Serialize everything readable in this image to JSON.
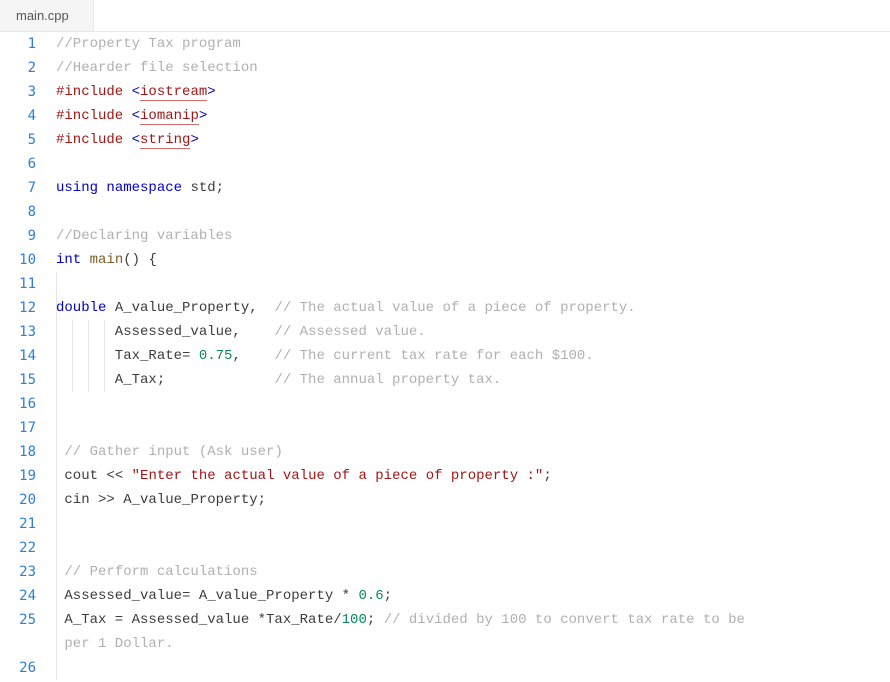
{
  "tab": {
    "filename": "main.cpp"
  },
  "lines": [
    {
      "num": "1",
      "tokens": [
        [
          "comment",
          "//Property Tax program"
        ]
      ]
    },
    {
      "num": "2",
      "tokens": [
        [
          "comment",
          "//Hearder file selection"
        ]
      ]
    },
    {
      "num": "3",
      "tokens": [
        [
          "preproc",
          "#include "
        ],
        [
          "angle",
          "<"
        ],
        [
          "include",
          "iostream"
        ],
        [
          "angle",
          ">"
        ]
      ]
    },
    {
      "num": "4",
      "tokens": [
        [
          "preproc",
          "#include "
        ],
        [
          "angle",
          "<"
        ],
        [
          "include",
          "iomanip"
        ],
        [
          "angle",
          ">"
        ]
      ]
    },
    {
      "num": "5",
      "tokens": [
        [
          "preproc",
          "#include "
        ],
        [
          "angle",
          "<"
        ],
        [
          "include",
          "string"
        ],
        [
          "angle",
          ">"
        ]
      ]
    },
    {
      "num": "6",
      "tokens": []
    },
    {
      "num": "7",
      "tokens": [
        [
          "keyword",
          "using"
        ],
        [
          "ident",
          " "
        ],
        [
          "keyword",
          "namespace"
        ],
        [
          "ident",
          " std"
        ],
        [
          "op",
          ";"
        ]
      ]
    },
    {
      "num": "8",
      "tokens": []
    },
    {
      "num": "9",
      "tokens": [
        [
          "comment",
          "//Declaring variables"
        ]
      ]
    },
    {
      "num": "10",
      "tokens": [
        [
          "keyword",
          "int"
        ],
        [
          "ident",
          " "
        ],
        [
          "func",
          "main"
        ],
        [
          "op",
          "() {"
        ]
      ]
    },
    {
      "num": "11",
      "tokens": [],
      "guides": [
        0
      ]
    },
    {
      "num": "12",
      "tokens": [
        [
          "keyword",
          "double"
        ],
        [
          "ident",
          " A_value_Property,  "
        ],
        [
          "comment",
          "// The actual value of a piece of property."
        ]
      ],
      "guides": [
        0
      ]
    },
    {
      "num": "13",
      "tokens": [
        [
          "ident",
          "       Assessed_value,    "
        ],
        [
          "comment",
          "// Assessed value."
        ]
      ],
      "guides": [
        0,
        16,
        32,
        48
      ]
    },
    {
      "num": "14",
      "tokens": [
        [
          "ident",
          "       Tax_Rate= "
        ],
        [
          "number",
          "0.75"
        ],
        [
          "ident",
          ",    "
        ],
        [
          "comment",
          "// The current tax rate for each $100."
        ]
      ],
      "guides": [
        0,
        16,
        32,
        48
      ]
    },
    {
      "num": "15",
      "tokens": [
        [
          "ident",
          "       A_Tax;             "
        ],
        [
          "comment",
          "// The annual property tax."
        ]
      ],
      "guides": [
        0,
        16,
        32,
        48
      ]
    },
    {
      "num": "16",
      "tokens": [],
      "guides": [
        0
      ]
    },
    {
      "num": "17",
      "tokens": [],
      "guides": [
        0
      ]
    },
    {
      "num": "18",
      "tokens": [
        [
          "ident",
          " "
        ],
        [
          "comment",
          "// Gather input (Ask user)"
        ]
      ],
      "guides": [
        0
      ]
    },
    {
      "num": "19",
      "tokens": [
        [
          "ident",
          " cout "
        ],
        [
          "op",
          "<<"
        ],
        [
          "ident",
          " "
        ],
        [
          "string",
          "\"Enter the actual value of a piece of property :\""
        ],
        [
          "op",
          ";"
        ]
      ],
      "guides": [
        0
      ]
    },
    {
      "num": "20",
      "tokens": [
        [
          "ident",
          " cin "
        ],
        [
          "op",
          ">>"
        ],
        [
          "ident",
          " A_value_Property"
        ],
        [
          "op",
          ";"
        ]
      ],
      "guides": [
        0
      ]
    },
    {
      "num": "21",
      "tokens": [],
      "guides": [
        0
      ]
    },
    {
      "num": "22",
      "tokens": [],
      "guides": [
        0
      ]
    },
    {
      "num": "23",
      "tokens": [
        [
          "ident",
          " "
        ],
        [
          "comment",
          "// Perform calculations"
        ]
      ],
      "guides": [
        0
      ]
    },
    {
      "num": "24",
      "tokens": [
        [
          "ident",
          " Assessed_value= A_value_Property * "
        ],
        [
          "number",
          "0.6"
        ],
        [
          "op",
          ";"
        ]
      ],
      "guides": [
        0
      ]
    },
    {
      "num": "25",
      "tokens": [
        [
          "ident",
          " A_Tax = Assessed_value *Tax_Rate/"
        ],
        [
          "number",
          "100"
        ],
        [
          "op",
          ";"
        ],
        [
          "ident",
          " "
        ],
        [
          "comment",
          "// divided by 100 to convert tax rate to be "
        ]
      ],
      "guides": [
        0
      ]
    },
    {
      "num": "",
      "tokens": [
        [
          "comment",
          " per 1 Dollar."
        ]
      ],
      "wrap": true,
      "guides": [
        0
      ]
    },
    {
      "num": "26",
      "tokens": [],
      "guides": [
        0
      ]
    }
  ]
}
